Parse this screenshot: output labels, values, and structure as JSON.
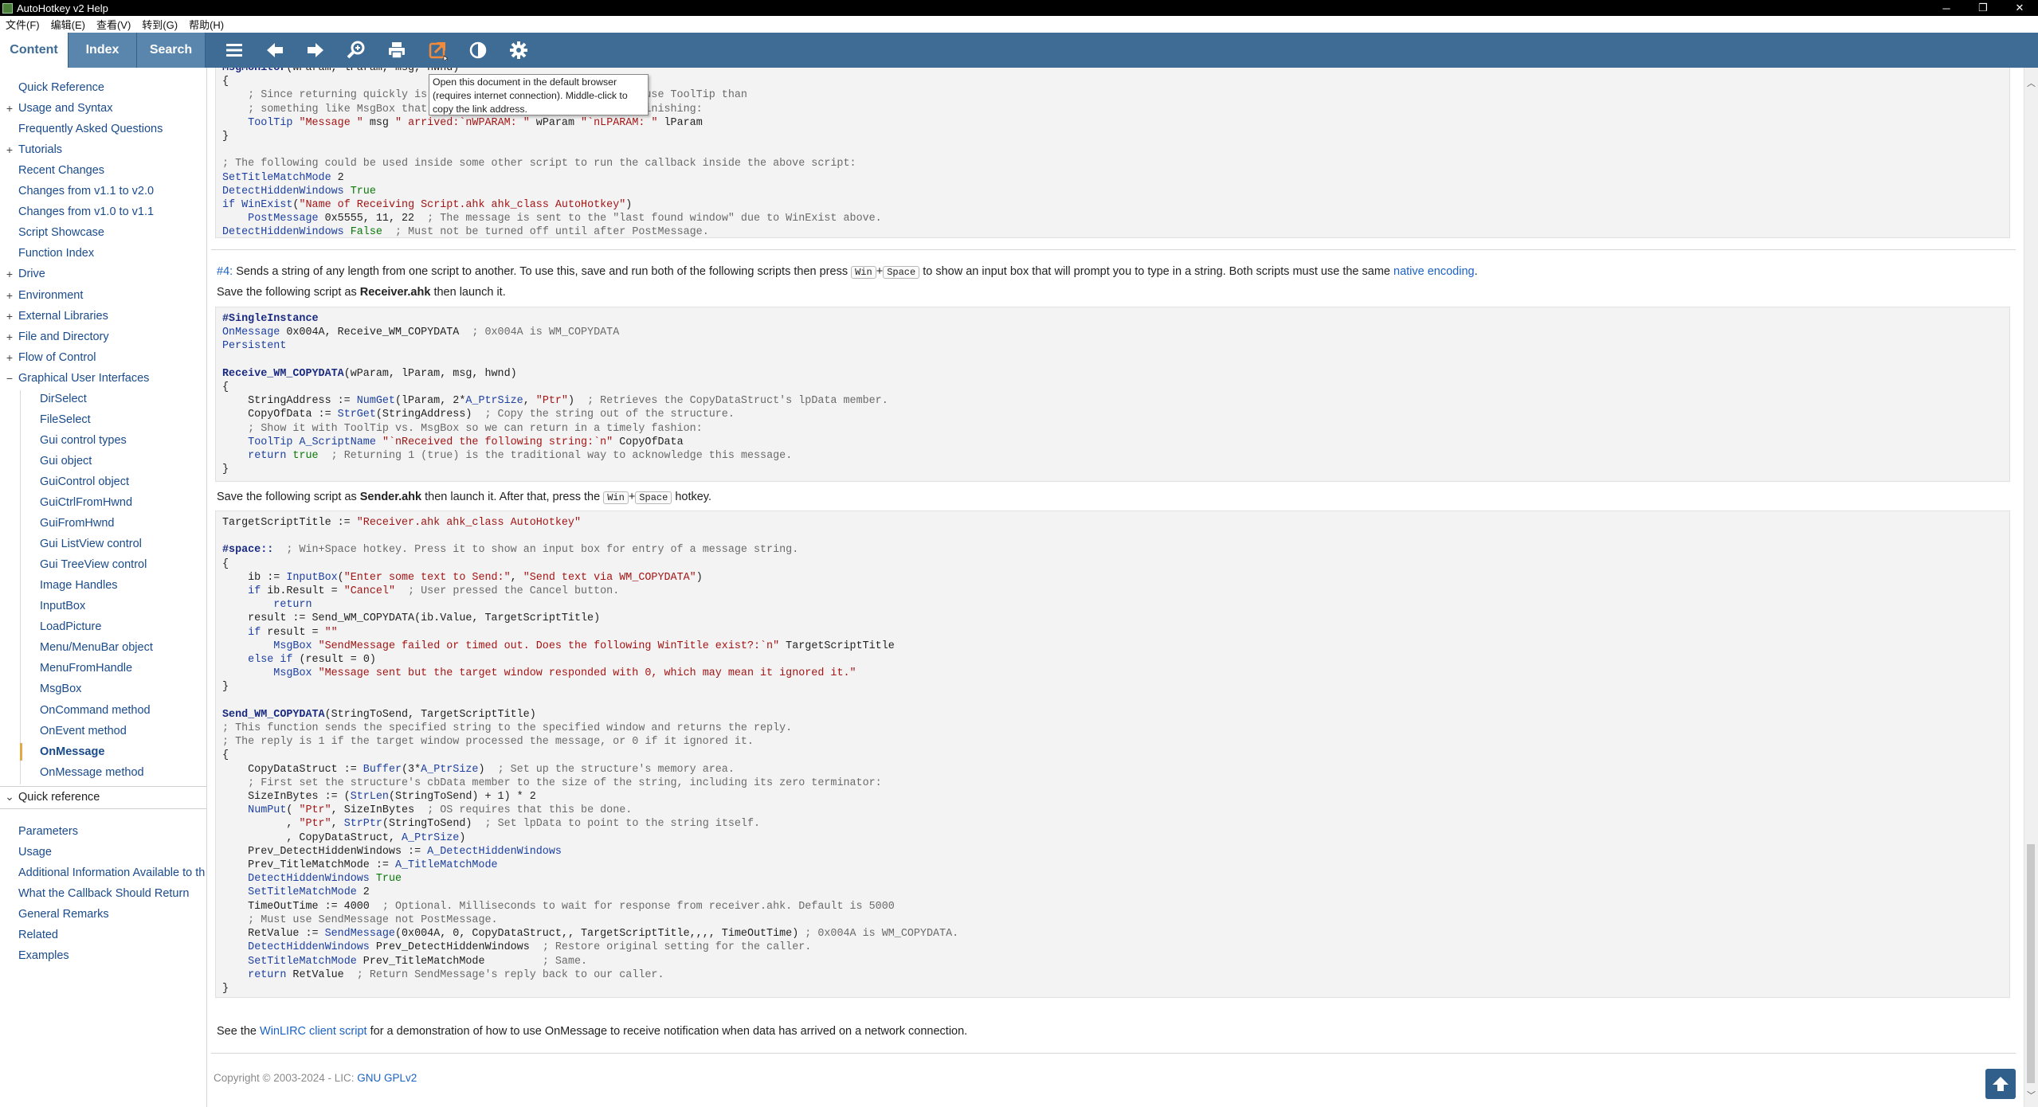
{
  "window": {
    "title": "AutoHotkey v2 Help",
    "min_icon": "minimize-icon",
    "max_icon": "restore-icon",
    "close_icon": "close-icon"
  },
  "menu": [
    "文件(F)",
    "编辑(E)",
    "查看(V)",
    "转到(G)",
    "帮助(H)"
  ],
  "tabs": {
    "content": "Content",
    "index": "Index",
    "search": "Search"
  },
  "toolbar": {
    "icons": [
      "menu-icon",
      "back-arrow-icon",
      "forward-arrow-icon",
      "zoom-icon",
      "print-icon",
      "open-in-browser-icon",
      "contrast-icon",
      "settings-icon"
    ],
    "tooltip": "Open this document in the default browser\n(requires internet connection). Middle-click to\ncopy the link address."
  },
  "sidebar": {
    "items": [
      {
        "label": "Quick Reference",
        "level": 0,
        "toggle": ""
      },
      {
        "label": "Usage and Syntax",
        "level": 0,
        "toggle": "+"
      },
      {
        "label": "Frequently Asked Questions",
        "level": 0,
        "toggle": ""
      },
      {
        "label": "Tutorials",
        "level": 0,
        "toggle": "+"
      },
      {
        "label": "Recent Changes",
        "level": 0,
        "toggle": ""
      },
      {
        "label": "Changes from v1.1 to v2.0",
        "level": 0,
        "toggle": ""
      },
      {
        "label": "Changes from v1.0 to v1.1",
        "level": 0,
        "toggle": ""
      },
      {
        "label": "Script Showcase",
        "level": 0,
        "toggle": ""
      },
      {
        "label": "Function Index",
        "level": 0,
        "toggle": ""
      },
      {
        "label": "Drive",
        "level": 0,
        "toggle": "+"
      },
      {
        "label": "Environment",
        "level": 0,
        "toggle": "+"
      },
      {
        "label": "External Libraries",
        "level": 0,
        "toggle": "+"
      },
      {
        "label": "File and Directory",
        "level": 0,
        "toggle": "+"
      },
      {
        "label": "Flow of Control",
        "level": 0,
        "toggle": "+"
      },
      {
        "label": "Graphical User Interfaces",
        "level": 0,
        "toggle": "−"
      },
      {
        "label": "DirSelect",
        "level": 1,
        "toggle": ""
      },
      {
        "label": "FileSelect",
        "level": 1,
        "toggle": ""
      },
      {
        "label": "Gui control types",
        "level": 1,
        "toggle": ""
      },
      {
        "label": "Gui object",
        "level": 1,
        "toggle": ""
      },
      {
        "label": "GuiControl object",
        "level": 1,
        "toggle": ""
      },
      {
        "label": "GuiCtrlFromHwnd",
        "level": 1,
        "toggle": ""
      },
      {
        "label": "GuiFromHwnd",
        "level": 1,
        "toggle": ""
      },
      {
        "label": "Gui ListView control",
        "level": 1,
        "toggle": ""
      },
      {
        "label": "Gui TreeView control",
        "level": 1,
        "toggle": ""
      },
      {
        "label": "Image Handles",
        "level": 1,
        "toggle": ""
      },
      {
        "label": "InputBox",
        "level": 1,
        "toggle": ""
      },
      {
        "label": "LoadPicture",
        "level": 1,
        "toggle": ""
      },
      {
        "label": "Menu/MenuBar object",
        "level": 1,
        "toggle": ""
      },
      {
        "label": "MenuFromHandle",
        "level": 1,
        "toggle": ""
      },
      {
        "label": "MsgBox",
        "level": 1,
        "toggle": ""
      },
      {
        "label": "OnCommand method",
        "level": 1,
        "toggle": ""
      },
      {
        "label": "OnEvent method",
        "level": 1,
        "toggle": ""
      },
      {
        "label": "OnMessage",
        "level": 1,
        "toggle": "",
        "selected": true
      },
      {
        "label": "OnMessage method",
        "level": 1,
        "toggle": ""
      }
    ],
    "quickref_header": "Quick reference",
    "quickref_items": [
      "Parameters",
      "Usage",
      "Additional Information Available to th",
      "What the Callback Should Return",
      "General Remarks",
      "Related",
      "Examples"
    ]
  },
  "content": {
    "code1_lines": [
      "MsgMonitor(wParam, lParam, msg, hwnd)",
      "{",
      "    ; Since returning quickly is often important, it is better to use ToolTip than",
      "    ; something like MsgBox that would prevent the callback from finishing:",
      "    ToolTip \"Message \" msg \" arrived:`nWPARAM: \" wParam \"`nLPARAM: \" lParam",
      "}",
      "",
      "; The following could be used inside some other script to run the callback inside the above script:",
      "SetTitleMatchMode 2",
      "DetectHiddenWindows True",
      "if WinExist(\"Name of Receiving Script.ahk ahk_class AutoHotkey\")",
      "    PostMessage 0x5555, 11, 22  ; The message is sent to the \"last found window\" due to WinExist above.",
      "DetectHiddenWindows False  ; Must not be turned off until after PostMessage."
    ],
    "ex4": {
      "num": "#4:",
      "text_a": " Sends a string of any length from one script to another. To use this, save and run both of the following scripts then press ",
      "key_win": "Win",
      "plus": "+",
      "key_space": "Space",
      "text_b": " to show an input box that will prompt you to type in a string. Both scripts must use the same ",
      "link": "native encoding",
      "text_c": "."
    },
    "save1": {
      "a": "Save the following script as ",
      "file": "Receiver.ahk",
      "b": " then launch it."
    },
    "code2_lines": [
      "#SingleInstance",
      "OnMessage 0x004A, Receive_WM_COPYDATA  ; 0x004A is WM_COPYDATA",
      "Persistent",
      "",
      "Receive_WM_COPYDATA(wParam, lParam, msg, hwnd)",
      "{",
      "    StringAddress := NumGet(lParam, 2*A_PtrSize, \"Ptr\")  ; Retrieves the CopyDataStruct's lpData member.",
      "    CopyOfData := StrGet(StringAddress)  ; Copy the string out of the structure.",
      "    ; Show it with ToolTip vs. MsgBox so we can return in a timely fashion:",
      "    ToolTip A_ScriptName \"`nReceived the following string:`n\" CopyOfData",
      "    return true  ; Returning 1 (true) is the traditional way to acknowledge this message.",
      "}"
    ],
    "save2": {
      "a": "Save the following script as ",
      "file": "Sender.ahk",
      "b": " then launch it. After that, press the ",
      "key_win": "Win",
      "plus": "+",
      "key_space": "Space",
      "c": " hotkey."
    },
    "code3_lines": [
      "TargetScriptTitle := \"Receiver.ahk ahk_class AutoHotkey\"",
      "",
      "#space::  ; Win+Space hotkey. Press it to show an input box for entry of a message string.",
      "{",
      "    ib := InputBox(\"Enter some text to Send:\", \"Send text via WM_COPYDATA\")",
      "    if ib.Result = \"Cancel\"  ; User pressed the Cancel button.",
      "        return",
      "    result := Send_WM_COPYDATA(ib.Value, TargetScriptTitle)",
      "    if result = \"\"",
      "        MsgBox \"SendMessage failed or timed out. Does the following WinTitle exist?:`n\" TargetScriptTitle",
      "    else if (result = 0)",
      "        MsgBox \"Message sent but the target window responded with 0, which may mean it ignored it.\"",
      "}",
      "",
      "Send_WM_COPYDATA(StringToSend, TargetScriptTitle)",
      "; This function sends the specified string to the specified window and returns the reply.",
      "; The reply is 1 if the target window processed the message, or 0 if it ignored it.",
      "{",
      "    CopyDataStruct := Buffer(3*A_PtrSize)  ; Set up the structure's memory area.",
      "    ; First set the structure's cbData member to the size of the string, including its zero terminator:",
      "    SizeInBytes := (StrLen(StringToSend) + 1) * 2",
      "    NumPut( \"Ptr\", SizeInBytes  ; OS requires that this be done.",
      "          , \"Ptr\", StrPtr(StringToSend)  ; Set lpData to point to the string itself.",
      "          , CopyDataStruct, A_PtrSize)",
      "    Prev_DetectHiddenWindows := A_DetectHiddenWindows",
      "    Prev_TitleMatchMode := A_TitleMatchMode",
      "    DetectHiddenWindows True",
      "    SetTitleMatchMode 2",
      "    TimeOutTime := 4000  ; Optional. Milliseconds to wait for response from receiver.ahk. Default is 5000",
      "    ; Must use SendMessage not PostMessage.",
      "    RetValue := SendMessage(0x004A, 0, CopyDataStruct,, TargetScriptTitle,,,, TimeOutTime) ; 0x004A is WM_COPYDATA.",
      "    DetectHiddenWindows Prev_DetectHiddenWindows  ; Restore original setting for the caller.",
      "    SetTitleMatchMode Prev_TitleMatchMode         ; Same.",
      "    return RetValue  ; Return SendMessage's reply back to our caller.",
      "}"
    ],
    "see_also": {
      "a": "See the ",
      "link": "WinLIRC client script",
      "b": " for a demonstration of how to use OnMessage to receive notification when data has arrived on a network connection."
    },
    "footer": {
      "text": "Copyright © 2003-2024 - LIC: ",
      "link": "GNU GPLv2"
    }
  },
  "colors": {
    "toolbar_bg": "#3f6c95",
    "link": "#1b62c4",
    "selected_marker": "#e2a94b",
    "comment": "#6a6a6a",
    "string": "#a31515"
  }
}
